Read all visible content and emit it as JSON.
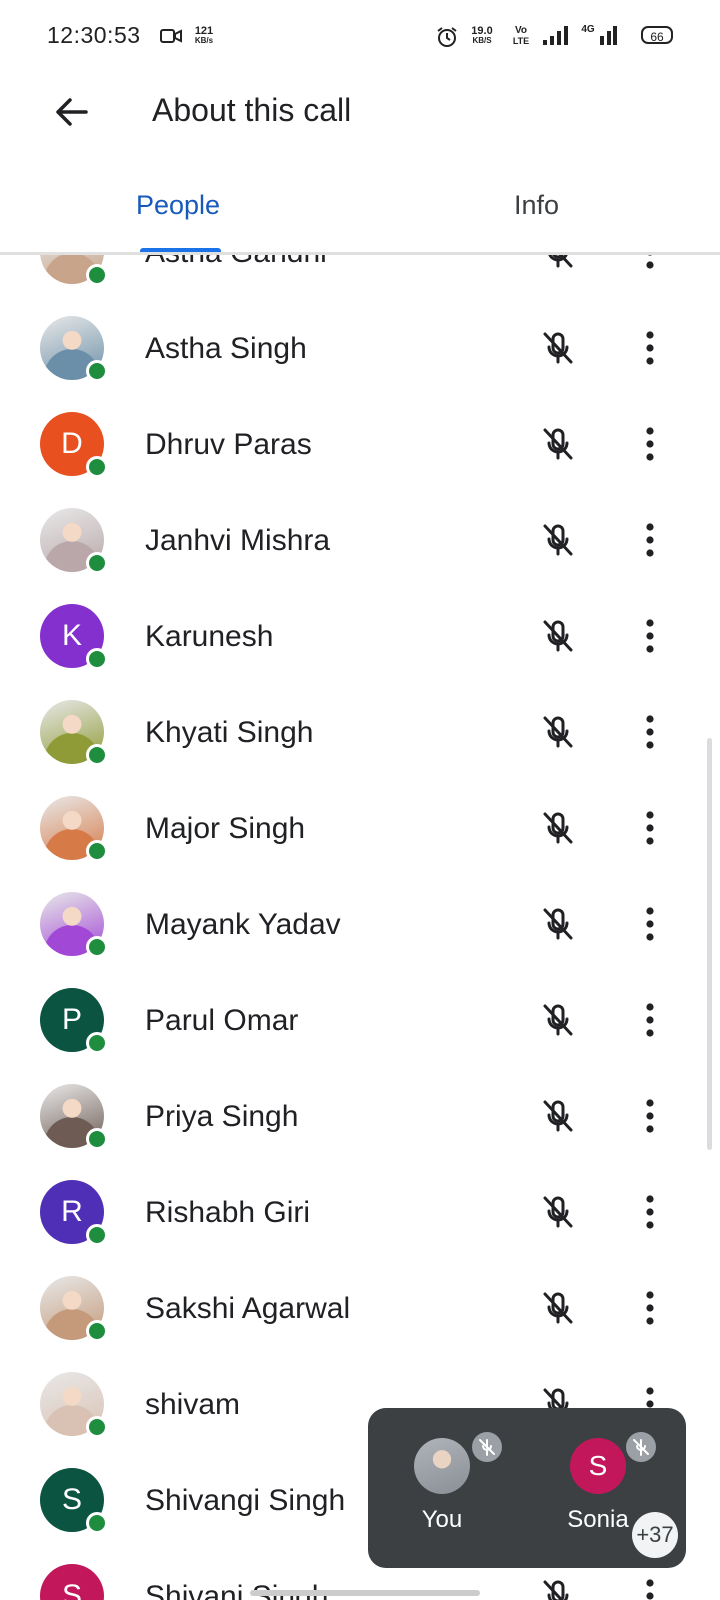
{
  "status_bar": {
    "time": "12:30:53",
    "speed_left_top": "121",
    "speed_left_bottom": "KB/s",
    "speed_right_top": "19.0",
    "speed_right_bottom": "KB/S",
    "volte_top": "Vo",
    "volte_bottom": "LTE",
    "network": "4G",
    "battery": "66"
  },
  "header": {
    "title": "About this call"
  },
  "tabs": [
    {
      "label": "People",
      "selected": true
    },
    {
      "label": "Info",
      "selected": false
    }
  ],
  "participants": [
    {
      "name": "Astha Gandhi",
      "avatar": "photo",
      "color": "#c7a48a",
      "online": true,
      "muted": true
    },
    {
      "name": "Astha Singh",
      "avatar": "photo",
      "color": "#6b8fa8",
      "online": true,
      "muted": true
    },
    {
      "name": "Dhruv Paras",
      "avatar": "letter",
      "initial": "D",
      "color": "#e8501f",
      "online": true,
      "muted": true
    },
    {
      "name": "Janhvi Mishra",
      "avatar": "photo",
      "color": "#b9a7a9",
      "online": true,
      "muted": true
    },
    {
      "name": "Karunesh",
      "avatar": "letter",
      "initial": "K",
      "color": "#8430ce",
      "online": true,
      "muted": true
    },
    {
      "name": "Khyati Singh",
      "avatar": "photo",
      "color": "#8f9b36",
      "online": true,
      "muted": true
    },
    {
      "name": "Major Singh",
      "avatar": "photo",
      "color": "#d67b48",
      "online": true,
      "muted": true
    },
    {
      "name": "Mayank Yadav",
      "avatar": "photo",
      "color": "#a248d6",
      "online": true,
      "muted": true
    },
    {
      "name": "Parul Omar",
      "avatar": "letter",
      "initial": "P",
      "color": "#0b5442",
      "online": true,
      "muted": true
    },
    {
      "name": "Priya Singh",
      "avatar": "photo",
      "color": "#6e5c54",
      "online": true,
      "muted": true
    },
    {
      "name": "Rishabh Giri",
      "avatar": "letter",
      "initial": "R",
      "color": "#4e2fb5",
      "online": true,
      "muted": true
    },
    {
      "name": "Sakshi Agarwal",
      "avatar": "photo",
      "color": "#c49a7a",
      "online": true,
      "muted": true
    },
    {
      "name": "shivam",
      "avatar": "photo",
      "color": "#d9c2b3",
      "online": true,
      "muted": true
    },
    {
      "name": "Shivangi Singh",
      "avatar": "letter",
      "initial": "S",
      "color": "#0b5442",
      "online": true,
      "muted": true
    },
    {
      "name": "Shivani Singh",
      "avatar": "letter",
      "initial": "S",
      "color": "#c2185b",
      "online": true,
      "muted": true
    }
  ],
  "floating_panel": {
    "tiles": [
      {
        "name": "You",
        "avatar": "photo",
        "color": "#8a8f96"
      },
      {
        "name": "Sonia",
        "avatar": "letter",
        "initial": "S",
        "color": "#c2185b"
      }
    ],
    "more_count": "+37"
  }
}
